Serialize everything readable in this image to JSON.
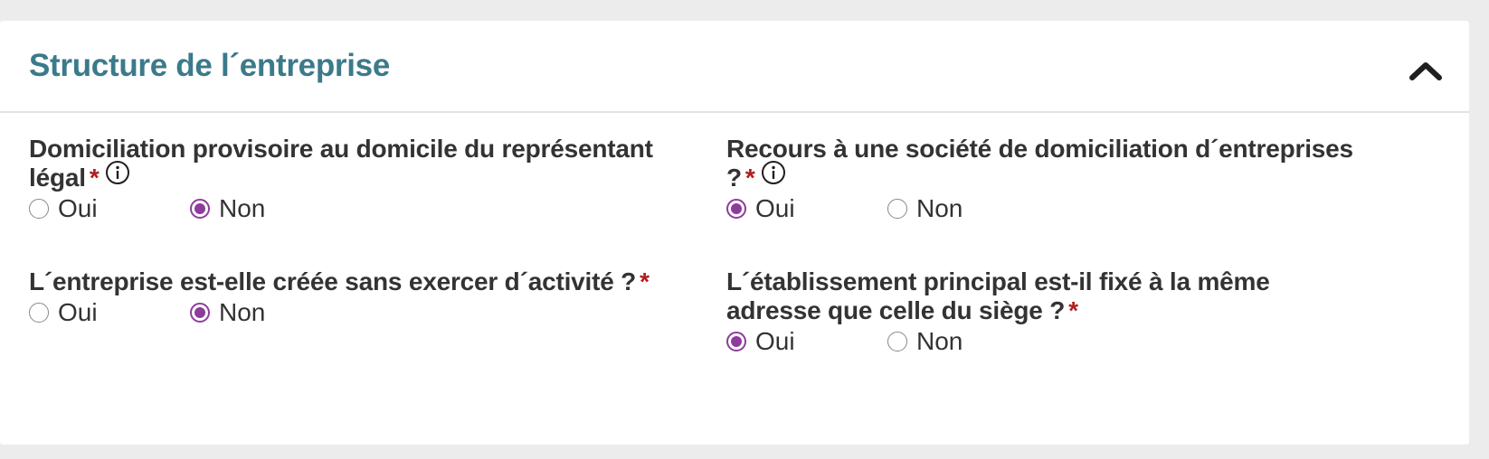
{
  "section": {
    "title": "Structure de l´entreprise",
    "collapse_icon": "chevron-up-icon"
  },
  "fields": [
    {
      "label_line1": "Domiciliation provisoire au domicile du représentant",
      "label_line2": "légal",
      "required_mark": "*",
      "has_info": true,
      "options": [
        "Oui",
        "Non"
      ],
      "selected": "Non"
    },
    {
      "label_line1": "Recours à une société de domiciliation d´entreprises",
      "label_line2": "?",
      "required_mark": "*",
      "has_info": true,
      "options": [
        "Oui",
        "Non"
      ],
      "selected": "Oui"
    },
    {
      "label_line1": "L´entreprise est-elle créée sans exercer d´activité ?",
      "required_mark": "*",
      "has_info": false,
      "options": [
        "Oui",
        "Non"
      ],
      "selected": "Non"
    },
    {
      "label_line1": "L´établissement principal est-il fixé à la même",
      "label_line2": "adresse que celle du siège ?",
      "required_mark": "*",
      "has_info": false,
      "options": [
        "Oui",
        "Non"
      ],
      "selected": "Oui"
    }
  ],
  "colors": {
    "title": "#3b7a8a",
    "radio_checked": "#8e3c9c",
    "required": "#b01e1e",
    "background": "#ececec"
  }
}
